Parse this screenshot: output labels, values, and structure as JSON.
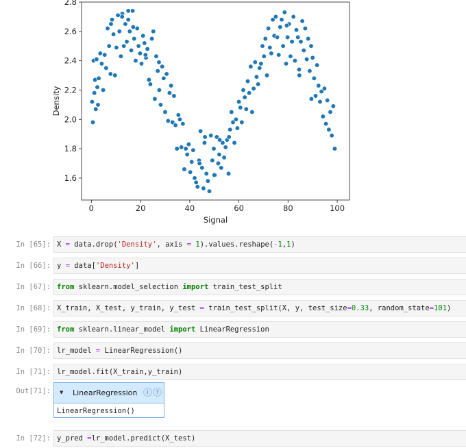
{
  "chart_data": {
    "type": "scatter",
    "xlabel": "Signal",
    "ylabel": "Density",
    "xlim": [
      -4,
      105
    ],
    "ylim": [
      1.45,
      2.8
    ],
    "xticks": [
      0,
      20,
      40,
      60,
      80,
      100
    ],
    "yticks": [
      1.6,
      1.8,
      2.0,
      2.2,
      2.4,
      2.6,
      2.8
    ],
    "color": "#1f77b4",
    "x": [
      0.3,
      0.6,
      0.9,
      1.2,
      1.5,
      1.8,
      2.1,
      2.4,
      2.7,
      3.0,
      3.6,
      4.2,
      4.8,
      5.4,
      6.0,
      6.6,
      7.2,
      7.8,
      8.4,
      9.0,
      9.6,
      10.2,
      10.8,
      11.4,
      12.0,
      12.6,
      13.2,
      13.8,
      14.4,
      15.0,
      15.6,
      16.2,
      16.8,
      17.4,
      18.0,
      18.6,
      19.2,
      19.8,
      20.4,
      21.0,
      21.6,
      22.2,
      22.8,
      23.4,
      24.0,
      24.6,
      25.2,
      25.8,
      26.4,
      27.0,
      27.6,
      28.2,
      28.8,
      29.4,
      30.0,
      30.6,
      31.2,
      31.8,
      32.4,
      33.0,
      33.6,
      34.2,
      34.8,
      35.4,
      36.0,
      36.6,
      37.2,
      37.8,
      38.4,
      39.0,
      39.6,
      40.2,
      40.8,
      41.4,
      42.0,
      42.6,
      43.2,
      43.8,
      44.4,
      45.0,
      45.6,
      46.2,
      46.8,
      47.4,
      48.0,
      48.6,
      49.2,
      49.8,
      50.4,
      51.0,
      51.6,
      52.2,
      52.8,
      53.4,
      54.0,
      54.6,
      55.2,
      55.8,
      56.4,
      57.0,
      57.6,
      58.2,
      58.8,
      59.4,
      60.0,
      60.6,
      61.2,
      61.8,
      62.4,
      63.0,
      63.6,
      64.2,
      64.8,
      65.4,
      66.0,
      66.6,
      67.2,
      67.8,
      68.4,
      69.0,
      69.6,
      70.2,
      70.8,
      71.4,
      72.0,
      72.6,
      73.2,
      73.8,
      74.4,
      75.0,
      75.6,
      76.2,
      76.8,
      77.4,
      78.0,
      78.6,
      79.2,
      79.8,
      80.4,
      81.0,
      81.6,
      82.2,
      82.8,
      83.4,
      84.0,
      84.6,
      85.2,
      85.8,
      86.4,
      87.0,
      87.6,
      88.2,
      88.8,
      89.4,
      90.0,
      90.6,
      91.2,
      91.8,
      92.4,
      93.0,
      93.6,
      94.2,
      94.8,
      95.4,
      96.0,
      96.6,
      97.2,
      97.8,
      98.4,
      99.0,
      8.0,
      12.5,
      17.0,
      22.0,
      27.5,
      44.0,
      50.0,
      56.0,
      79.5,
      84.5,
      89.5,
      15.0,
      46.0,
      52.0
    ],
    "y": [
      2.12,
      1.98,
      2.4,
      2.18,
      2.27,
      2.07,
      2.41,
      2.22,
      2.1,
      2.28,
      2.45,
      2.38,
      2.2,
      2.44,
      2.35,
      2.62,
      2.5,
      2.31,
      2.68,
      2.58,
      2.3,
      2.49,
      2.71,
      2.6,
      2.43,
      2.72,
      2.5,
      2.65,
      2.53,
      2.68,
      2.6,
      2.47,
      2.74,
      2.55,
      2.4,
      2.62,
      2.5,
      2.45,
      2.38,
      2.57,
      2.52,
      2.42,
      2.48,
      2.27,
      2.24,
      2.55,
      2.6,
      2.14,
      2.43,
      2.33,
      2.2,
      2.1,
      2.36,
      2.28,
      2.05,
      2.31,
      1.99,
      2.18,
      2.23,
      1.98,
      2.16,
      1.96,
      1.8,
      2.03,
      2.0,
      1.81,
      1.97,
      1.66,
      1.8,
      1.76,
      1.83,
      1.64,
      1.71,
      1.79,
      1.6,
      1.57,
      1.54,
      1.72,
      1.92,
      1.67,
      1.53,
      1.88,
      1.63,
      1.58,
      1.51,
      1.89,
      1.72,
      1.8,
      1.62,
      1.88,
      1.7,
      1.86,
      1.67,
      1.84,
      1.74,
      1.81,
      1.86,
      1.63,
      1.93,
      2.05,
      1.98,
      1.84,
      2.0,
      1.94,
      2.12,
      2.08,
      1.98,
      2.2,
      2.15,
      2.07,
      2.26,
      2.18,
      2.36,
      2.05,
      2.21,
      2.39,
      2.29,
      2.24,
      2.35,
      2.38,
      2.5,
      2.43,
      2.55,
      2.3,
      2.62,
      2.49,
      2.45,
      2.68,
      2.57,
      2.7,
      2.56,
      2.44,
      2.63,
      2.68,
      2.5,
      2.73,
      2.38,
      2.56,
      2.65,
      2.43,
      2.53,
      2.7,
      2.4,
      2.61,
      2.56,
      2.3,
      2.53,
      2.67,
      2.47,
      2.62,
      2.41,
      2.55,
      2.33,
      2.5,
      2.42,
      2.28,
      2.16,
      2.37,
      2.23,
      2.12,
      2.19,
      2.02,
      2.21,
      1.97,
      2.13,
      1.93,
      2.05,
      1.89,
      2.09,
      1.8,
      2.65,
      2.7,
      2.63,
      2.44,
      2.39,
      1.7,
      1.62,
      1.88,
      2.64,
      2.34,
      2.14,
      2.74,
      1.84,
      1.76
    ]
  },
  "cells": [
    {
      "prompt": "In [65]:",
      "code": [
        {
          "t": "X "
        },
        {
          "t": "=",
          "c": "op"
        },
        {
          "t": " data.drop("
        },
        {
          "t": "'Density'",
          "c": "str"
        },
        {
          "t": ", axis "
        },
        {
          "t": "=",
          "c": "op"
        },
        {
          "t": " "
        },
        {
          "t": "1",
          "c": "num"
        },
        {
          "t": ").values.reshape("
        },
        {
          "t": "-",
          "c": "op"
        },
        {
          "t": "1",
          "c": "num"
        },
        {
          "t": ","
        },
        {
          "t": "1",
          "c": "num"
        },
        {
          "t": ")"
        }
      ]
    },
    {
      "prompt": "In [66]:",
      "code": [
        {
          "t": "y "
        },
        {
          "t": "=",
          "c": "op"
        },
        {
          "t": " data["
        },
        {
          "t": "'Density'",
          "c": "str"
        },
        {
          "t": "]"
        }
      ]
    },
    {
      "prompt": "In [67]:",
      "code": [
        {
          "t": "from",
          "c": "kw"
        },
        {
          "t": " sklearn.model_selection "
        },
        {
          "t": "import",
          "c": "kw"
        },
        {
          "t": " train_test_split"
        }
      ]
    },
    {
      "prompt": "In [68]:",
      "code": [
        {
          "t": "X_train, X_test, y_train, y_test "
        },
        {
          "t": "=",
          "c": "op"
        },
        {
          "t": " train_test_split(X, y, test_size"
        },
        {
          "t": "=",
          "c": "op"
        },
        {
          "t": "0.33",
          "c": "num"
        },
        {
          "t": ", random_state"
        },
        {
          "t": "=",
          "c": "op"
        },
        {
          "t": "101",
          "c": "num"
        },
        {
          "t": ")"
        }
      ]
    },
    {
      "prompt": "In [69]:",
      "code": [
        {
          "t": "from",
          "c": "kw"
        },
        {
          "t": " sklearn.linear_model "
        },
        {
          "t": "import",
          "c": "kw"
        },
        {
          "t": " LinearRegression"
        }
      ]
    },
    {
      "prompt": "In [70]:",
      "code": [
        {
          "t": "lr_model "
        },
        {
          "t": "=",
          "c": "op"
        },
        {
          "t": " LinearRegression()"
        }
      ]
    },
    {
      "prompt": "In [71]:",
      "code": [
        {
          "t": "lr_model.fit(X_train,y_train)"
        }
      ]
    },
    {
      "prompt": "In [72]:",
      "code": [
        {
          "t": "y_pred "
        },
        {
          "t": "=",
          "c": "op"
        },
        {
          "t": "lr_model.predict(X_test)"
        }
      ]
    }
  ],
  "output": {
    "prompt": "Out[71]:",
    "estimator_name": "LinearRegression",
    "badge_info": "i",
    "badge_help": "?",
    "repr": "LinearRegression()"
  }
}
